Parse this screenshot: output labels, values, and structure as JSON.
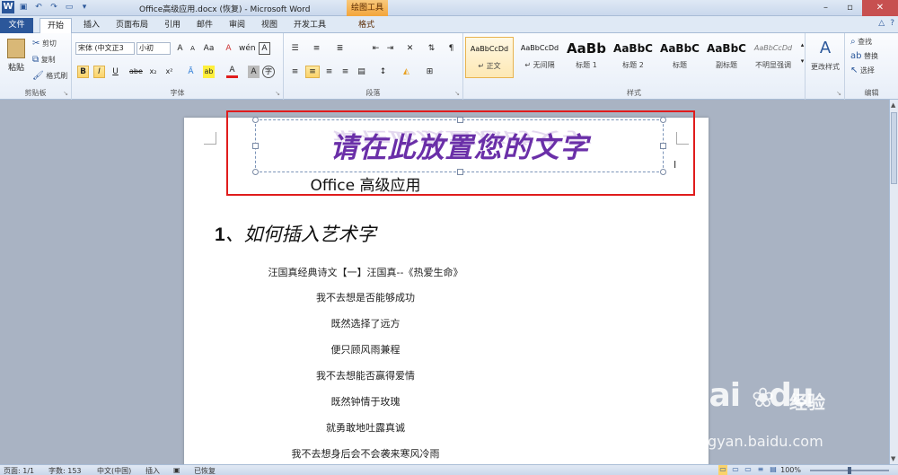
{
  "titlebar": {
    "title": "Office高级应用.docx (恢复) - Microsoft Word",
    "contextual_tab": "绘图工具",
    "app_icon": "W",
    "qat_icons": [
      "save-icon",
      "undo-icon",
      "redo-icon",
      "open-folder-icon",
      "customize-icon"
    ]
  },
  "tabs": {
    "file": "文件",
    "items": [
      "开始",
      "插入",
      "页面布局",
      "引用",
      "邮件",
      "审阅",
      "视图",
      "开发工具",
      "格式"
    ]
  },
  "ribbon": {
    "clipboard": {
      "label": "剪贴板",
      "paste": "粘贴",
      "cut": "剪切",
      "copy": "复制",
      "format_painter": "格式刷"
    },
    "font": {
      "label": "字体",
      "font_name": "宋体 (中文正3",
      "font_size": "小初",
      "bold": "B",
      "italic": "I",
      "underline": "U",
      "strike": "abe",
      "subscript": "x₂",
      "superscript": "x²",
      "grow": "A",
      "shrink": "A",
      "change_case": "Aa",
      "clear": "A",
      "char_border": "A",
      "highlight": "ab",
      "font_color": "A",
      "char_shade": "A",
      "enclose": "字",
      "phonetic": "wén"
    },
    "paragraph": {
      "label": "段落"
    },
    "styles": {
      "label": "样式",
      "items": [
        {
          "sample": "AaBbCcDd",
          "name": "↵ 正文"
        },
        {
          "sample": "AaBbCcDd",
          "name": "↵ 无间隔"
        },
        {
          "sample": "AaBb",
          "name": "标题 1"
        },
        {
          "sample": "AaBbC",
          "name": "标题 2"
        },
        {
          "sample": "AaBbC",
          "name": "标题"
        },
        {
          "sample": "AaBbC",
          "name": "副标题"
        },
        {
          "sample": "AaBbCcDd",
          "name": "不明显强调"
        }
      ],
      "change_styles": "更改样式"
    },
    "editing": {
      "label": "编辑",
      "find": "查找",
      "replace": "替换",
      "select": "选择"
    }
  },
  "document": {
    "wordart": "请在此放置您的文字",
    "subtitle": "Office 高级应用",
    "heading_number": "1",
    "heading_text": "、如何插入艺术字",
    "lines": [
      "汪国真经典诗文【一】汪国真--《热爱生命》",
      "我不去想是否能够成功",
      "既然选择了远方",
      "便只顾风雨兼程",
      "我不去想能否赢得爱情",
      "既然钟情于玫瑰",
      "就勇敢地吐露真诚",
      "我不去想身后会不会袭来寒风冷雨"
    ]
  },
  "statusbar": {
    "page": "页面: 1/1",
    "words": "字数: 153",
    "language": "中文(中国)",
    "mode": "插入",
    "recovered": "已恢复",
    "zoom": "100%",
    "zoom_fraction": 0.5
  },
  "watermark": {
    "logo": "Bai",
    "logo2": "du",
    "brand_cn": "经验",
    "url": "jingyan.baidu.com"
  },
  "colors": {
    "accent": "#2b579a",
    "wordart": "#6a2fa8",
    "highlight": "#e01c1c",
    "contextual": "#f3a53b"
  }
}
